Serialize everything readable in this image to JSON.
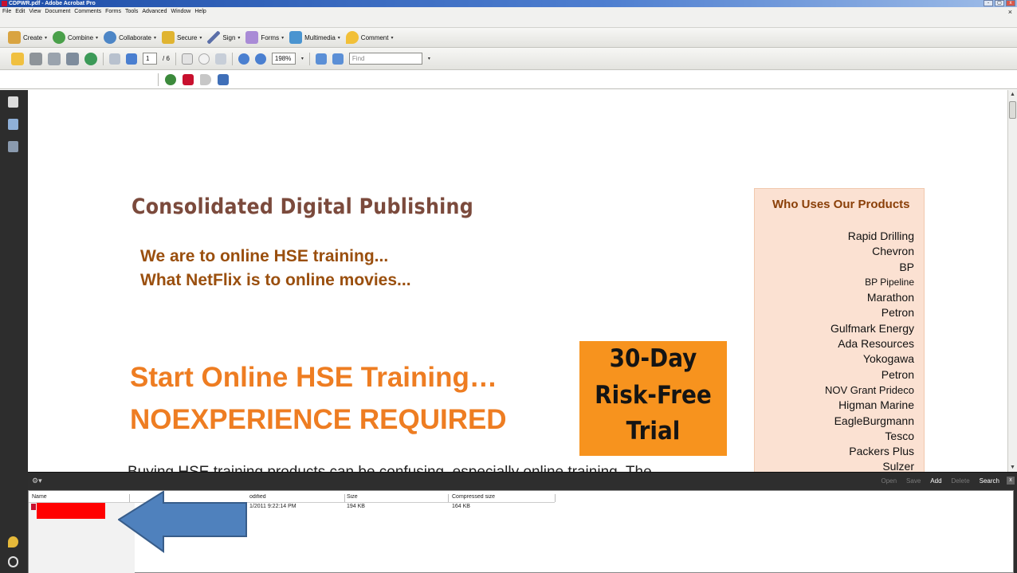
{
  "window": {
    "title": "CDPWR.pdf - Adobe Acrobat Pro",
    "controls": {
      "min": "-",
      "max": "▢",
      "close": "x"
    }
  },
  "menu": {
    "items": [
      "File",
      "Edit",
      "View",
      "Document",
      "Comments",
      "Forms",
      "Tools",
      "Advanced",
      "Window",
      "Help"
    ],
    "doc_close": "×"
  },
  "tasks": {
    "create": "Create",
    "combine": "Combine",
    "collaborate": "Collaborate",
    "secure": "Secure",
    "sign": "Sign",
    "forms": "Forms",
    "multimedia": "Multimedia",
    "comment": "Comment"
  },
  "navbar": {
    "page_current": "1",
    "page_total": "/ 6",
    "zoom": "198%",
    "find_placeholder": "Find"
  },
  "document": {
    "title": "Consolidated Digital Publishing",
    "tagline1": "We are to online HSE training...",
    "tagline2": "What NetFlix  is to online movies...",
    "headline1": "Start Online HSE Training…",
    "headline2": "NOEXPERIENCE REQUIRED",
    "trial": [
      "30-Day",
      "Risk-Free",
      "Trial"
    ],
    "body_partial": "Buying HSE training products can be confusing, especially online training. The",
    "customers": {
      "heading": "Who Uses Our Products",
      "list": [
        "Rapid Drilling",
        "Chevron",
        "BP",
        "BP Pipeline",
        "Marathon",
        "Petron",
        "Gulfmark Energy",
        "Ada Resources",
        "Yokogawa",
        "Petron",
        "NOV Grant Prideco",
        "Higman Marine",
        "EagleBurgmann",
        "Tesco",
        "Packers Plus",
        "Sulzer"
      ]
    }
  },
  "attachments": {
    "options": "⚙▾",
    "actions": {
      "open": "Open",
      "save": "Save",
      "add": "Add",
      "delete": "Delete",
      "search": "Search"
    },
    "close": "x",
    "columns": {
      "name": "Name",
      "modified": "odified",
      "size": "Size",
      "compressed": "Compressed size"
    },
    "rows": [
      {
        "modified": "1/2011 9:22:14 PM",
        "size": "194 KB",
        "compressed": "164 KB"
      }
    ]
  },
  "colors": {
    "title_brown": "#7b4a3c",
    "tagline_brown": "#9a4f0e",
    "headline_orange": "#ee7d22",
    "trial_orange": "#f7931e",
    "panel_peach": "#fbe1d2",
    "redaction_red": "#ff0000",
    "arrow_blue": "#4f81bd"
  }
}
